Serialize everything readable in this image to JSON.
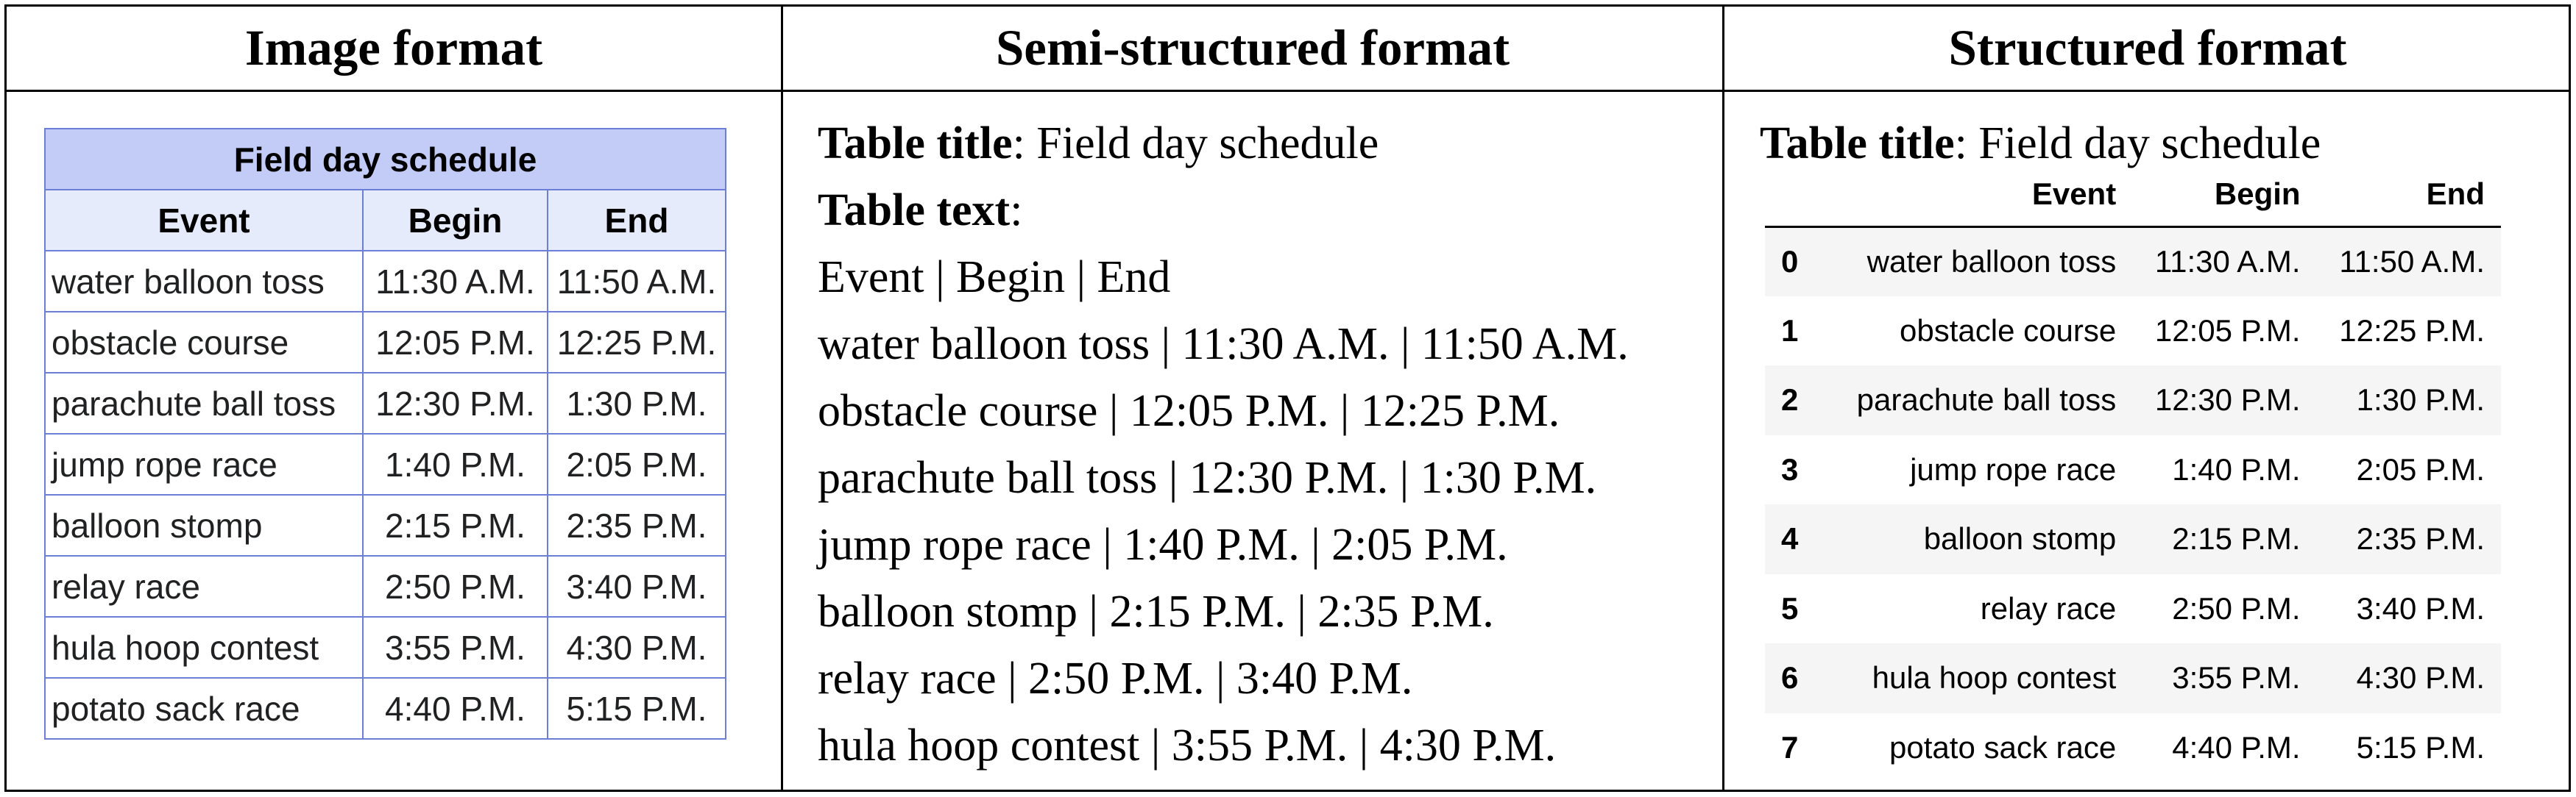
{
  "headers": {
    "image": "Image format",
    "semi": "Semi-structured format",
    "structured": "Structured format"
  },
  "table": {
    "title": "Field day schedule",
    "columns": [
      "Event",
      "Begin",
      "End"
    ],
    "rows": [
      [
        "water balloon toss",
        "11:30 A.M.",
        "11:50 A.M."
      ],
      [
        "obstacle course",
        "12:05 P.M.",
        "12:25 P.M."
      ],
      [
        "parachute ball toss",
        "12:30 P.M.",
        "1:30 P.M."
      ],
      [
        "jump rope race",
        "1:40 P.M.",
        "2:05 P.M."
      ],
      [
        "balloon stomp",
        "2:15 P.M.",
        "2:35 P.M."
      ],
      [
        "relay race",
        "2:50 P.M.",
        "3:40 P.M."
      ],
      [
        "hula hoop contest",
        "3:55 P.M.",
        "4:30 P.M."
      ],
      [
        "potato sack race",
        "4:40 P.M.",
        "5:15 P.M."
      ]
    ]
  },
  "semi": {
    "title_label": "Table title",
    "title_value": "Field day schedule",
    "text_label": "Table text",
    "lines": [
      "Event | Begin | End",
      "water balloon toss | 11:30 A.M. | 11:50 A.M.",
      "obstacle course | 12:05 P.M. | 12:25 P.M.",
      "parachute ball toss | 12:30 P.M. | 1:30 P.M.",
      "jump rope race | 1:40 P.M. | 2:05 P.M.",
      "balloon stomp | 2:15 P.M. | 2:35 P.M.",
      "relay race | 2:50 P.M. | 3:40 P.M.",
      "hula hoop contest | 3:55 P.M. | 4:30 P.M."
    ]
  },
  "structured": {
    "title_label": "Table title",
    "title_value": "Field day schedule",
    "index": [
      "0",
      "1",
      "2",
      "3",
      "4",
      "5",
      "6",
      "7"
    ]
  },
  "colors": {
    "caption_bg": "#c3cbf7",
    "header_bg": "#e6ebfb",
    "cell_border": "#6b7fd6",
    "stripe": "#f5f5f5"
  }
}
